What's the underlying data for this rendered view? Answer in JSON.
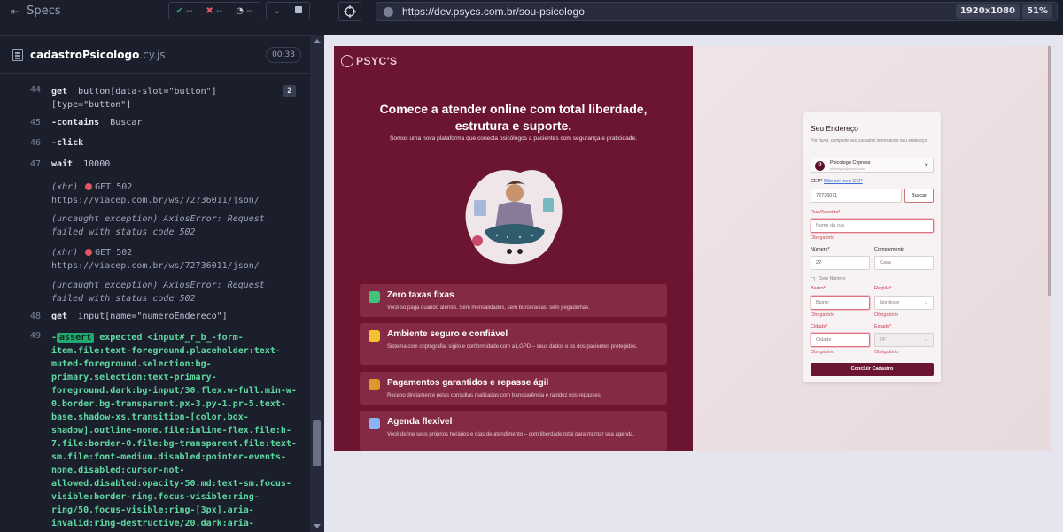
{
  "runner": {
    "specs_label": "Specs",
    "passed": "--",
    "failed": "--",
    "pending": "--",
    "file_name": "cadastroPsicologo",
    "file_ext": ".cy.js",
    "duration": "00:33"
  },
  "log": {
    "step44": {
      "num": "44",
      "cmd": "get",
      "arg": "button[data-slot=\"button\"]\n[type=\"button\"]",
      "count": "2"
    },
    "step45": {
      "num": "45",
      "cmd": "-contains",
      "arg": "Buscar"
    },
    "step46": {
      "num": "46",
      "cmd": "-click"
    },
    "step47": {
      "num": "47",
      "cmd": "wait",
      "arg": "10000"
    },
    "xhr1": {
      "prefix": "(xhr)",
      "method": "GET 502",
      "url": "https://viacep.com.br/ws/72736011/json/"
    },
    "exc1": {
      "text": "(uncaught exception)  AxiosError: Request\nfailed with status code 502"
    },
    "xhr2": {
      "prefix": "(xhr)",
      "method": "GET 502",
      "url": "https://viacep.com.br/ws/72736011/json/"
    },
    "exc2": {
      "text": "(uncaught exception)  AxiosError: Request\nfailed with status code 502"
    },
    "step48": {
      "num": "48",
      "cmd": "get",
      "arg": "input[name=\"numeroEndereco\"]"
    },
    "step49": {
      "num": "49",
      "dash": "-",
      "badge": "assert",
      "text": "expected  <input#_r_b_-form-\nitem.file:text-foreground.placeholder:text-\nmuted-foreground.selection:bg-\nprimary.selection:text-primary-\nforeground.dark:bg-input/30.flex.w-full.min-w-\n0.border.bg-transparent.px-3.py-1.pr-5.text-\nbase.shadow-xs.transition-[color,box-\nshadow].outline-none.file:inline-flex.file:h-\n7.file:border-0.file:bg-transparent.file:text-\nsm.file:font-medium.disabled:pointer-events-\nnone.disabled:cursor-not-\nallowed.disabled:opacity-50.md:text-sm.focus-\nvisible:border-ring.focus-visible:ring-\nring/50.focus-visible:ring-[3px].aria-\ninvalid:ring-destructive/20.dark:aria-"
    }
  },
  "browser": {
    "url": "https://dev.psycs.com.br/sou-psicologo",
    "viewport": "1920x1080",
    "zoom": "51%"
  },
  "app": {
    "logo": "PSYC'S",
    "hero_title": "Comece a atender online com total liberdade,\nestrutura e suporte.",
    "hero_sub": "Somos uma nova plataforma que conecta psicólogos a pacientes com segurança e praticidade.",
    "features": [
      {
        "title": "Zero taxas fixas",
        "desc": "Você só paga quando atende. Sem mensalidades, sem burocracias, sem pegadinhas.",
        "icon_color": "#3fc47a"
      },
      {
        "title": "Ambiente seguro e confiável",
        "desc": "Sistema com criptografia, sigilo e conformidade com a LGPD – seus dados e os dos pacientes protegidos.",
        "icon_color": "#f1c232"
      },
      {
        "title": "Pagamentos garantidos e repasse ágil",
        "desc": "Recebo diretamente pelas consultas realizadas com transparência e rapidez nos repasses.",
        "icon_color": "#d99a2b"
      },
      {
        "title": "Agenda flexível",
        "desc": "Você define seus próprios horários e dias de atendimento – com liberdade total para montar sua agenda.",
        "icon_color": "#8ab4f8"
      }
    ],
    "form": {
      "title": "Seu Endereço",
      "desc": "Por favor, complete seu cadastro informando seu endereço.",
      "user_initial": "P",
      "user_name": "Psicologo Cypress",
      "user_email": "testesgcs@gmail.com",
      "cep_label": "CEP*",
      "cep_link": "Não sei meu CEP",
      "cep_value": "72736011",
      "buscar": "Buscar",
      "rua_label": "Rua/Avenida*",
      "rua_placeholder": "Nome da rua",
      "required": "Obrigatório",
      "numero_label": "Número*",
      "numero_value": "22",
      "complemento_label": "Complemento",
      "complemento_placeholder": "Casa",
      "sem_numero": "Sem Número",
      "bairro_label": "Bairro*",
      "bairro_placeholder": "Bairro",
      "regiao_label": "Região*",
      "regiao_value": "Nordeste",
      "cidade_label": "Cidade*",
      "cidade_placeholder": "Cidade",
      "estado_label": "Estado*",
      "estado_value": "UF",
      "submit": "Concluir Cadastro"
    }
  }
}
